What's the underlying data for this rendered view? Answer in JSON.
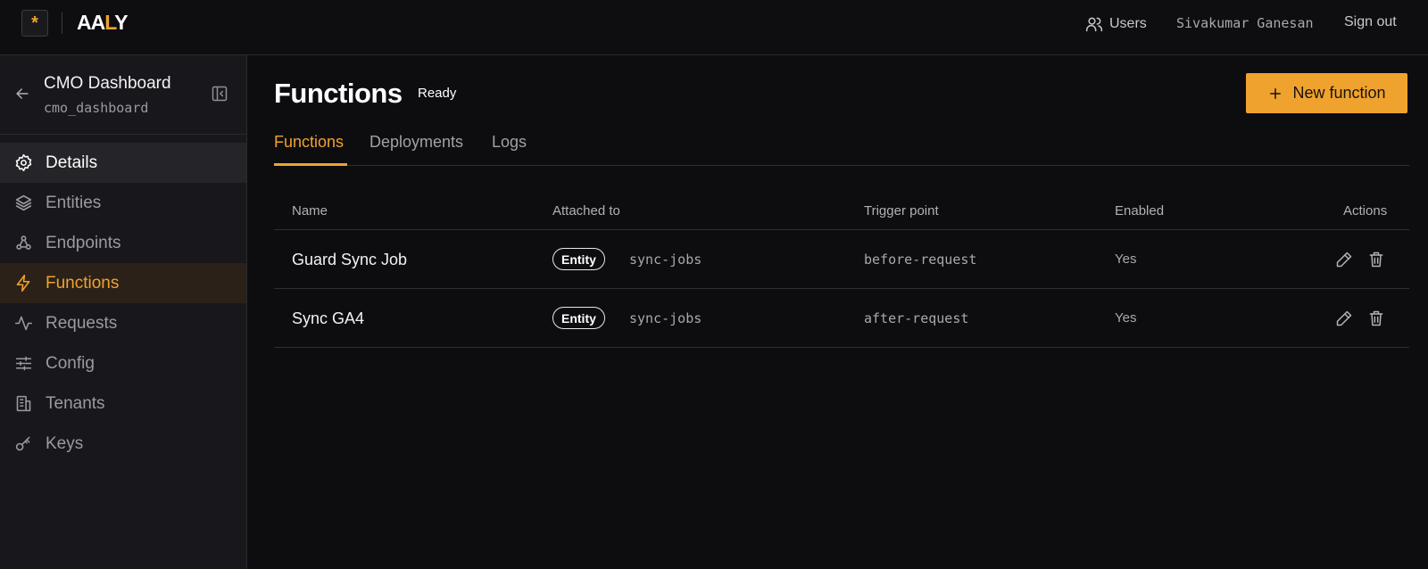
{
  "topbar": {
    "logo_glyph": "*",
    "brand_prefix": "AA",
    "brand_accent": "L",
    "brand_suffix": "Y",
    "users_label": "Users",
    "user_name": "Sivakumar Ganesan",
    "signout_label": "Sign out"
  },
  "sidebar": {
    "title": "CMO Dashboard",
    "subtitle": "cmo_dashboard",
    "items": [
      {
        "label": "Details",
        "icon": "gear-icon"
      },
      {
        "label": "Entities",
        "icon": "layers-icon"
      },
      {
        "label": "Endpoints",
        "icon": "webhook-icon"
      },
      {
        "label": "Functions",
        "icon": "lightning-icon"
      },
      {
        "label": "Requests",
        "icon": "activity-icon"
      },
      {
        "label": "Config",
        "icon": "sliders-icon"
      },
      {
        "label": "Tenants",
        "icon": "building-icon"
      },
      {
        "label": "Keys",
        "icon": "key-icon"
      }
    ]
  },
  "main": {
    "title": "Functions",
    "status": "Ready",
    "new_button_label": "New function",
    "tabs": [
      {
        "label": "Functions"
      },
      {
        "label": "Deployments"
      },
      {
        "label": "Logs"
      }
    ],
    "table": {
      "headers": [
        "Name",
        "Attached to",
        "Trigger point",
        "Enabled",
        "Actions"
      ],
      "rows": [
        {
          "name": "Guard Sync Job",
          "attached_type": "Entity",
          "attached_name": "sync-jobs",
          "trigger": "before-request",
          "enabled": "Yes"
        },
        {
          "name": "Sync GA4",
          "attached_type": "Entity",
          "attached_name": "sync-jobs",
          "trigger": "after-request",
          "enabled": "Yes"
        }
      ]
    }
  },
  "colors": {
    "accent": "#f0a22e",
    "background": "#0d0d10",
    "sidebar": "#18181c"
  }
}
